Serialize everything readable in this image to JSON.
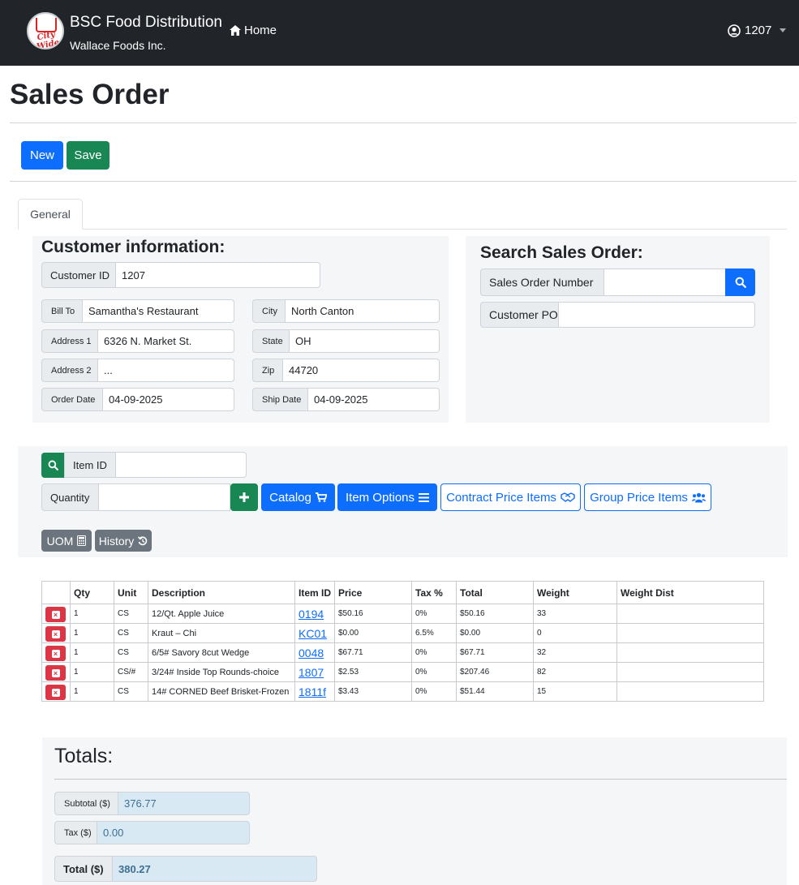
{
  "navbar": {
    "logo_text": "City Wide",
    "brand_title": "BSC Food Distribution",
    "brand_subtitle": "Wallace Foods Inc.",
    "home_label": "Home",
    "user_label": "1207"
  },
  "page": {
    "title": "Sales Order"
  },
  "toolbar": {
    "new_label": "New",
    "save_label": "Save"
  },
  "tabs": [
    {
      "label": "General"
    }
  ],
  "customer": {
    "heading": "Customer information:",
    "customer_id_label": "Customer ID",
    "customer_id": "1207",
    "bill_to_label": "Bill To",
    "bill_to": "Samantha's Restaurant",
    "city_label": "City",
    "city": "North Canton",
    "address1_label": "Address 1",
    "address1": "6326 N. Market St.",
    "state_label": "State",
    "state": "OH",
    "address2_label": "Address 2",
    "address2": "...",
    "zip_label": "Zip",
    "zip": "44720",
    "order_date_label": "Order Date",
    "order_date": "04-09-2025",
    "ship_date_label": "Ship Date",
    "ship_date": "04-09-2025"
  },
  "search": {
    "heading": "Search Sales Order:",
    "sales_order_label": "Sales Order Number",
    "sales_order_value": "",
    "customer_po_label": "Customer PO",
    "customer_po_value": ""
  },
  "item_entry": {
    "item_id_label": "Item ID",
    "item_id_value": "",
    "quantity_label": "Quantity",
    "quantity_value": "",
    "catalog_label": "Catalog",
    "item_options_label": "Item Options",
    "contract_label": "Contract Price Items",
    "group_label": "Group Price Items",
    "uom_label": "UOM",
    "history_label": "History"
  },
  "table": {
    "headers": [
      "",
      "Qty",
      "Unit",
      "Description",
      "Item ID",
      "Price",
      "Tax %",
      "Total",
      "Weight",
      "Weight Dist"
    ],
    "rows": [
      {
        "qty": "1",
        "unit": "CS",
        "description": "12/Qt. Apple Juice",
        "item_id": "0194",
        "price": "$50.16",
        "tax": "0%",
        "total": "$50.16",
        "weight": "33",
        "weight_dist": ""
      },
      {
        "qty": "1",
        "unit": "CS",
        "description": "Kraut – Chi",
        "item_id": "KC01",
        "price": "$0.00",
        "tax": "6.5%",
        "total": "$0.00",
        "weight": "0",
        "weight_dist": ""
      },
      {
        "qty": "1",
        "unit": "CS",
        "description": "6/5# Savory 8cut Wedge",
        "item_id": "0048",
        "price": "$67.71",
        "tax": "0%",
        "total": "$67.71",
        "weight": "32",
        "weight_dist": ""
      },
      {
        "qty": "1",
        "unit": "CS/#",
        "description": "3/24# Inside Top Rounds-choice",
        "item_id": "1807",
        "price": "$2.53",
        "tax": "0%",
        "total": "$207.46",
        "weight": "82",
        "weight_dist": ""
      },
      {
        "qty": "1",
        "unit": "CS",
        "description": "14# CORNED Beef Brisket-Frozen",
        "item_id": "1811f",
        "price": "$3.43",
        "tax": "0%",
        "total": "$51.44",
        "weight": "15",
        "weight_dist": ""
      }
    ]
  },
  "totals": {
    "heading": "Totals:",
    "subtotal_label": "Subtotal ($)",
    "subtotal": "376.77",
    "tax_label": "Tax ($)",
    "tax": "0.00",
    "total_label": "Total ($)",
    "total": "380.27"
  },
  "colors": {
    "primary": "#0d6efd",
    "success": "#198754",
    "danger": "#dc3545",
    "secondary": "#6c757d",
    "navbar": "#212529"
  }
}
